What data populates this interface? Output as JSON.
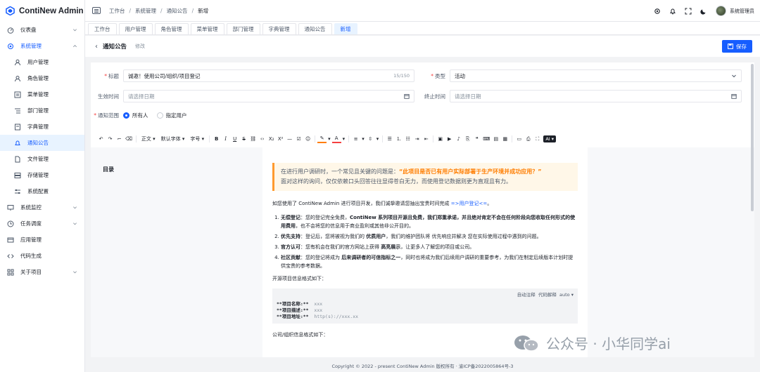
{
  "app": {
    "title": "ContiNew Admin"
  },
  "sidebar": {
    "items": [
      {
        "label": "仪表盘",
        "icon": "dashboard-icon",
        "expandable": true
      },
      {
        "label": "系统管理",
        "icon": "settings-icon",
        "expandable": true,
        "open": true
      },
      {
        "label": "用户管理",
        "icon": "user-icon",
        "sub": true
      },
      {
        "label": "角色管理",
        "icon": "role-icon",
        "sub": true
      },
      {
        "label": "菜单管理",
        "icon": "menu-icon",
        "sub": true
      },
      {
        "label": "部门管理",
        "icon": "dept-icon",
        "sub": true
      },
      {
        "label": "字典管理",
        "icon": "dict-icon",
        "sub": true
      },
      {
        "label": "通知公告",
        "icon": "bell-icon",
        "sub": true,
        "active": true
      },
      {
        "label": "文件管理",
        "icon": "file-icon",
        "sub": true
      },
      {
        "label": "存储管理",
        "icon": "storage-icon",
        "sub": true
      },
      {
        "label": "系统配置",
        "icon": "config-icon",
        "sub": true
      },
      {
        "label": "系统监控",
        "icon": "monitor-icon",
        "expandable": true
      },
      {
        "label": "任务调度",
        "icon": "clock-icon",
        "expandable": true
      },
      {
        "label": "应用管理",
        "icon": "app-icon"
      },
      {
        "label": "代码生成",
        "icon": "code-icon"
      },
      {
        "label": "关于项目",
        "icon": "grid-icon",
        "expandable": true
      }
    ]
  },
  "breadcrumb": [
    "工作台",
    "系统管理",
    "通知公告",
    "新增"
  ],
  "user": {
    "name": "系统管理员"
  },
  "tabs": [
    "工作台",
    "用户管理",
    "角色管理",
    "菜单管理",
    "部门管理",
    "字典管理",
    "通知公告",
    "新增"
  ],
  "active_tab": 7,
  "page": {
    "title": "通知公告",
    "subtitle": "修改",
    "save_label": "保存"
  },
  "form": {
    "title_label": "标题",
    "title_value": "诚邀！使用公司/组织/项目登记",
    "title_count": "15/150",
    "type_label": "类型",
    "type_value": "活动",
    "effective_label": "生效时间",
    "effective_placeholder": "请选择日期",
    "expire_label": "终止时间",
    "expire_placeholder": "请选择日期",
    "scope_label": "通知范围",
    "scope_options": [
      "所有人",
      "指定用户"
    ],
    "scope_selected": 0
  },
  "toolbar": {
    "paragraph": "正文",
    "font": "默认字体",
    "size": "字号",
    "ai": "AI"
  },
  "editor": {
    "toc_label": "目录",
    "quote_text": "在进行用户调研时，一个常见且关键的问题是：",
    "quote_highlight": "“此项目是否已有用户实际部署于生产环境并成功应用？”",
    "quote_line2": "面对这样的询问，仅仅依赖口头回答往往显得苍白无力，而使用登记数据则更为直观且有力。",
    "intro": "如您使用了 ContiNew Admin 进行项目开发，我们诚挚邀请您抽出宝贵时间完成 ",
    "intro_link": "=>用户登记<=",
    "intro_end": "。",
    "list": [
      {
        "head": "无偿登记",
        "body_pre": "：您的登记完全免费，",
        "bold": "ContiNew 系列项目开源且免费，我们郑重承诺，并且绝对肯定不会在任何阶段向您收取任何形式的使用费用",
        "body_post": "，也不会将您的信息用于商业盈利或其他非公开目的。"
      },
      {
        "head": "优先支持",
        "body_pre": "：登记后，您将被视为我们的 ",
        "bold": "优质用户",
        "body_post": "，我们的维护团队将 优先响应并解决 您在实际使用过程中遇到的问题。"
      },
      {
        "head": "官方认可",
        "body_pre": "：您有机会在我们的官方网站上获得 ",
        "bold": "高亮展示",
        "body_post": "，让更多人了解您的项目或公司。"
      },
      {
        "head": "社区贡献",
        "body_pre": "：您的登记将成为 ",
        "bold": "后来调研者的可信指标之一",
        "body_post": "，同时也将成为我们后续用户调研的重要参考，为我们在制定后续版本计划时提供宝贵的参考数据。"
      }
    ],
    "open_format_label": "开源项目信息格式如下：",
    "code_header": {
      "auto_comment": "自动注释",
      "code_explain": "代码解释",
      "lang": "auto"
    },
    "code_lines": [
      {
        "key": "**项目名称:**",
        "val": "xxx"
      },
      {
        "key": "**项目描述:**",
        "val": "xxx"
      },
      {
        "key": "**项目地址:**",
        "val": "http(s)://xxx.xx"
      }
    ],
    "company_format_label": "公司/组织信息格式如下："
  },
  "footer": {
    "text": "Copyright © 2022 - present ContiNew Admin 版权所有 · 渝ICP备2022005864号-3"
  },
  "watermark": {
    "text": "公众号 · 小华同学ai"
  },
  "colors": {
    "primary": "#165dff",
    "quote_bg": "#fff7e8",
    "quote_accent": "#ff7d00"
  }
}
